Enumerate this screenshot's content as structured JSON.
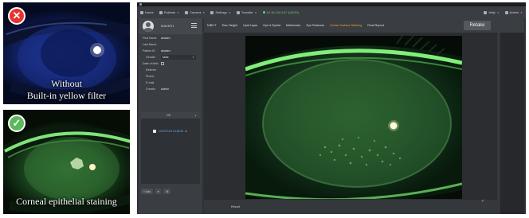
{
  "comparison": {
    "top_caption_line1": "Without",
    "top_caption_line2": "Built-in yellow filter",
    "top_badge": "✕",
    "bottom_caption": "Corneal epithelial staining",
    "bottom_badge": "✓",
    "colors": {
      "bad": "#e8332c",
      "good": "#5cb85c"
    }
  },
  "app": {
    "menu": [
      {
        "icon": "home-icon",
        "label": "Home"
      },
      {
        "icon": "patients-icon",
        "label": "Patients"
      },
      {
        "icon": "camera-icon",
        "label": "Camera"
      },
      {
        "icon": "settings-icon",
        "label": "Settings"
      },
      {
        "icon": "transfer-icon",
        "label": "Transfer"
      }
    ],
    "status": "10.18.100.107 1(2019)",
    "help_label": "Help",
    "user_label": "Admin",
    "sidebar": {
      "patient_name": "MAKER1",
      "fields": {
        "first_name": {
          "label": "First Name",
          "value": "ainaien"
        },
        "last_name": {
          "label": "Last Name",
          "value": ""
        },
        "patient_id": {
          "label": "Patient ID",
          "value": "ainaien"
        },
        "gender": {
          "label": "Gender",
          "value": "Male"
        },
        "dob": {
          "label": "Date of birth",
          "value": ""
        },
        "referrer": {
          "label": "Referrer",
          "value": ""
        },
        "phone": {
          "label": "Phone",
          "value": ""
        },
        "email": {
          "label": "E-mail",
          "value": ""
        },
        "creator": {
          "label": "Creator",
          "value": "Admin"
        }
      },
      "exam_header": "OS",
      "exam_entry": "2019/07/09 15:38:35",
      "buttons": [
        "+ Add",
        "▾",
        "⊞"
      ]
    },
    "tabs": [
      "NIBUT",
      "Tear Height",
      "Lipid Layer",
      "Eye & Eyelid",
      "Meibomian",
      "Eye Redness",
      "Ocular Surface Staining",
      "Final Report"
    ],
    "active_tab": "Ocular Surface Staining",
    "retake_label": "Retake",
    "bottom_label": "Result",
    "bottom_check": "✓"
  }
}
